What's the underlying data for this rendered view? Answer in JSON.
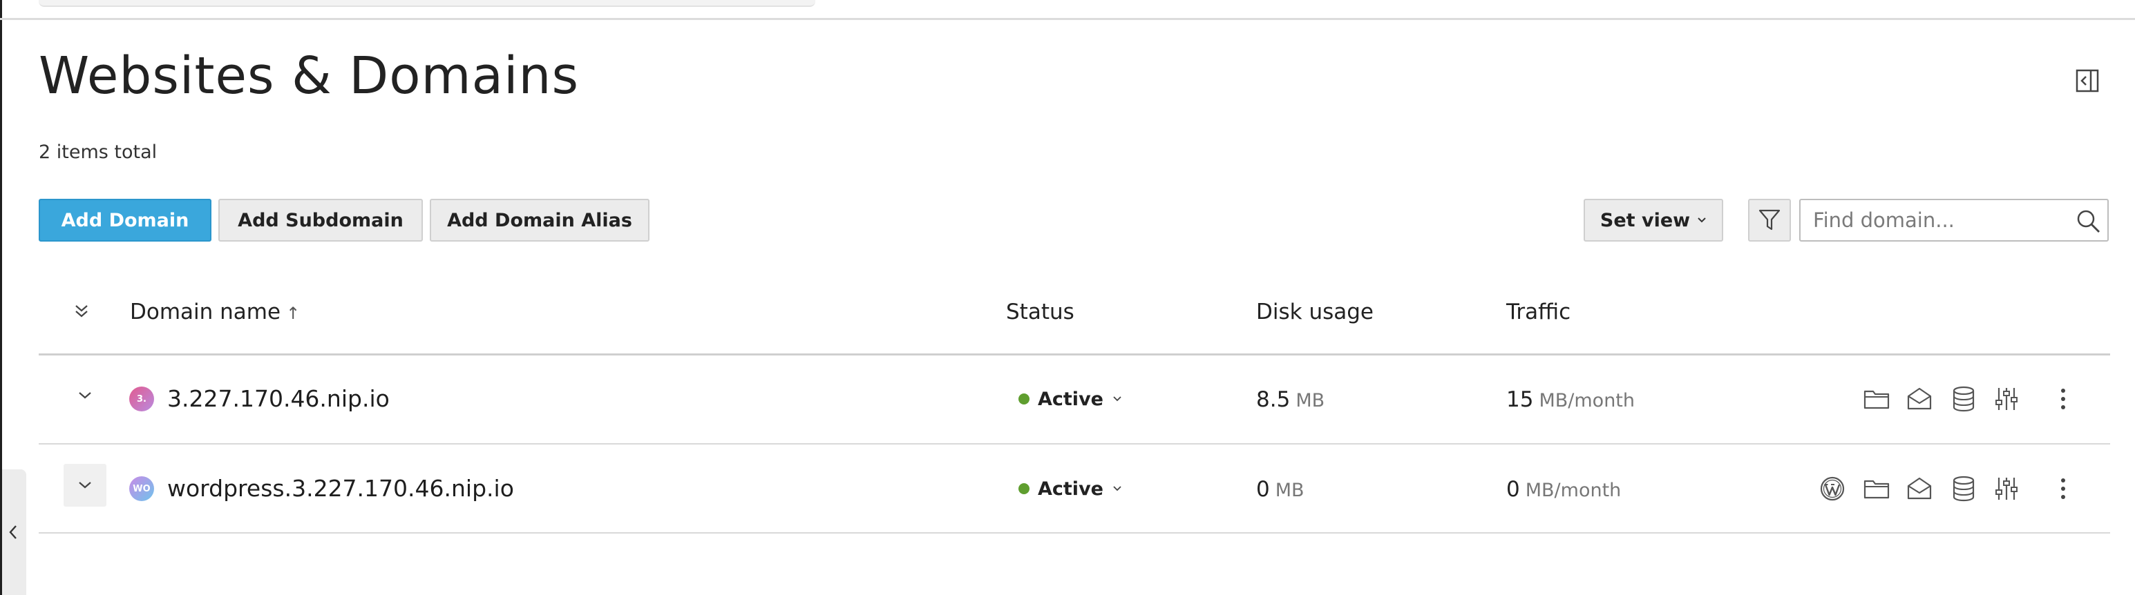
{
  "header": {
    "title": "Websites & Domains",
    "items_total": "2 items total"
  },
  "toolbar": {
    "add_domain_label": "Add Domain",
    "add_subdomain_label": "Add Subdomain",
    "add_alias_label": "Add Domain Alias",
    "set_view_label": "Set view",
    "search_placeholder": "Find domain..."
  },
  "table": {
    "columns": {
      "domain_name": "Domain name",
      "status": "Status",
      "disk_usage": "Disk usage",
      "traffic": "Traffic"
    },
    "sort_indicator": "↑",
    "rows": [
      {
        "favicon_text": "3.",
        "domain": "3.227.170.46.nip.io",
        "status": "Active",
        "disk_value": "8.5",
        "disk_unit": "MB",
        "traffic_value": "15",
        "traffic_unit": "MB/month",
        "actions": [
          "folder-icon",
          "mail-icon",
          "database-icon",
          "settings-sliders-icon",
          "more-vertical-icon"
        ]
      },
      {
        "favicon_text": "WO",
        "domain": "wordpress.3.227.170.46.nip.io",
        "status": "Active",
        "disk_value": "0",
        "disk_unit": "MB",
        "traffic_value": "0",
        "traffic_unit": "MB/month",
        "actions": [
          "wordpress-icon",
          "folder-icon",
          "mail-icon",
          "database-icon",
          "settings-sliders-icon",
          "more-vertical-icon"
        ]
      }
    ]
  },
  "colors": {
    "primary_button": "#3aa7dc",
    "status_active": "#5f9e2f"
  }
}
